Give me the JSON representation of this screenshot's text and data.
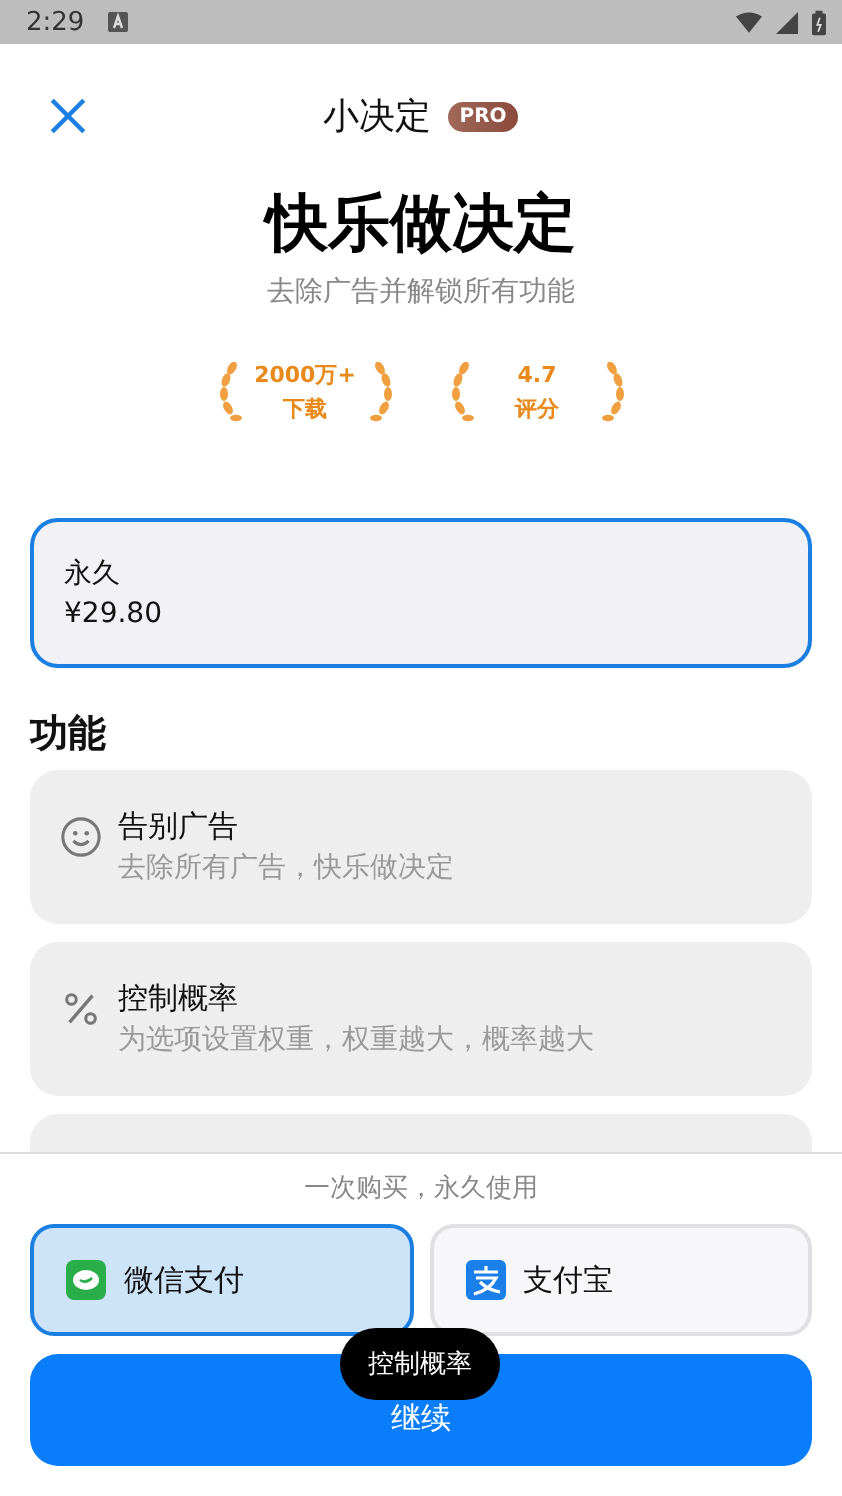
{
  "status_bar": {
    "time": "2:29"
  },
  "header": {
    "title": "小决定",
    "badge": "PRO"
  },
  "hero": {
    "title": "快乐做决定",
    "subtitle": "去除广告并解锁所有功能"
  },
  "stats": [
    {
      "value": "2000万+",
      "label": "下载"
    },
    {
      "value": "4.7",
      "label": "评分"
    }
  ],
  "plans": [
    {
      "name": "永久",
      "price": "¥29.80",
      "selected": true
    }
  ],
  "features_heading": "功能",
  "features": [
    {
      "kind": "smile",
      "title": "告别广告",
      "description": "去除所有广告，快乐做决定"
    },
    {
      "kind": "percent",
      "title": "控制概率",
      "description": "为选项设置权重，权重越大，概率越大"
    }
  ],
  "purchase_note": "一次购买，永久使用",
  "payment_methods": [
    {
      "kind": "wechat",
      "label": "微信支付",
      "selected": true
    },
    {
      "kind": "alipay",
      "label": "支付宝",
      "selected": false
    }
  ],
  "continue_button": "继续",
  "toast": "控制概率"
}
